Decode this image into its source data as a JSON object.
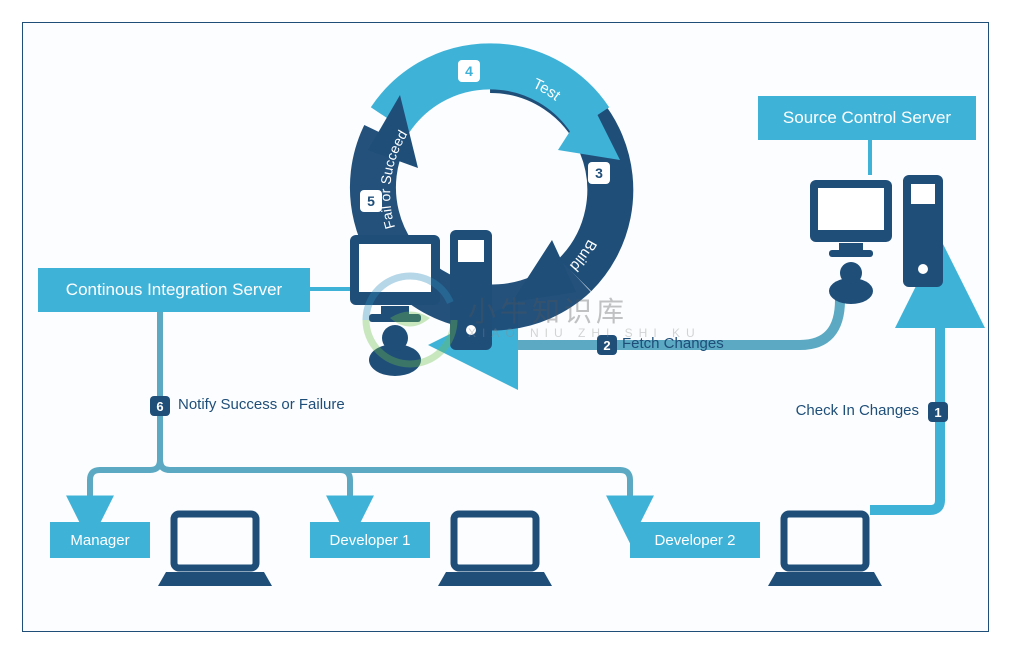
{
  "boxes": {
    "ci_server": "Continous Integration Server",
    "source_server": "Source Control Server",
    "manager": "Manager",
    "dev1": "Developer 1",
    "dev2": "Developer 2"
  },
  "steps": {
    "s1": {
      "num": "1",
      "label": "Check In Changes"
    },
    "s2": {
      "num": "2",
      "label": "Fetch Changes"
    },
    "s3": {
      "num": "3",
      "label": "Build"
    },
    "s4": {
      "num": "4",
      "label": "Test"
    },
    "s5": {
      "num": "5",
      "label": "Fail or Succeed"
    },
    "s6": {
      "num": "6",
      "label": "Notify Success or Failure"
    }
  },
  "watermark": {
    "main": "小牛知识库",
    "sub": "XIAO NIU ZHI SHI KU"
  },
  "colors": {
    "light": "#3fb2d8",
    "dark": "#1f4e79",
    "mid": "#5ba9c2"
  }
}
